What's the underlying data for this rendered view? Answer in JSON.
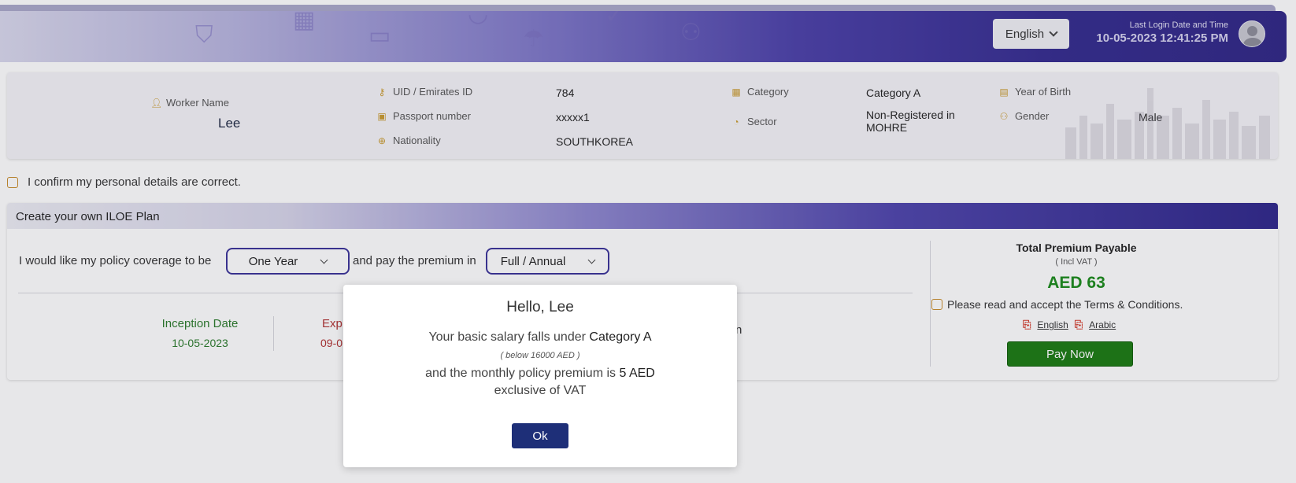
{
  "header": {
    "language": "English",
    "last_login_label": "Last Login Date and Time",
    "last_login_value": "10-05-2023 12:41:25 PM"
  },
  "worker": {
    "name_label": "Worker Name",
    "name_value": "Lee",
    "uid_label": "UID / Emirates ID",
    "uid_value": "784",
    "passport_label": "Passport number",
    "passport_value": "xxxxx1",
    "nationality_label": "Nationality",
    "nationality_value": "SOUTHKOREA",
    "category_label": "Category",
    "category_value": "Category A",
    "sector_label": "Sector",
    "sector_value_line1": "Non-Registered in",
    "sector_value_line2": "MOHRE",
    "yob_label": "Year of Birth",
    "yob_value": "",
    "gender_label": "Gender",
    "gender_value": "Male"
  },
  "confirm_text": "I confirm my personal details are correct.",
  "plan": {
    "title": "Create your own ILOE Plan",
    "coverage_prefix": "I would like my policy coverage to be",
    "coverage_value": "One Year",
    "premium_middle": "and pay the premium in",
    "payment_value": "Full / Annual",
    "inception_label": "Inception Date",
    "inception_value": "10-05-2023",
    "expiry_label": "Exp",
    "expiry_value": "09-0",
    "right_partial": "n"
  },
  "premium": {
    "title": "Total Premium Payable",
    "vat_note": "( Incl VAT )",
    "amount": "AED 63",
    "terms_text": "Please read and accept the Terms & Conditions.",
    "link_english": "English",
    "link_arabic": "Arabic",
    "pay_label": "Pay Now"
  },
  "modal": {
    "title": "Hello, ",
    "title_name": "Lee",
    "line1_prefix": "Your basic salary falls under",
    "line1_category": "Category A",
    "line2": "( below 16000 AED )",
    "line3_prefix": "and the monthly policy premium is",
    "line3_amount": "5 AED",
    "line4": "exclusive of VAT",
    "ok_label": "Ok"
  },
  "colors": {
    "brand_purple": "#2e2585",
    "pay_green": "#1a7a10",
    "ok_navy": "#1e2f78",
    "amount_green": "#1a8a1a",
    "inception_green": "#2a7a2a",
    "expiry_red": "#b03030"
  }
}
